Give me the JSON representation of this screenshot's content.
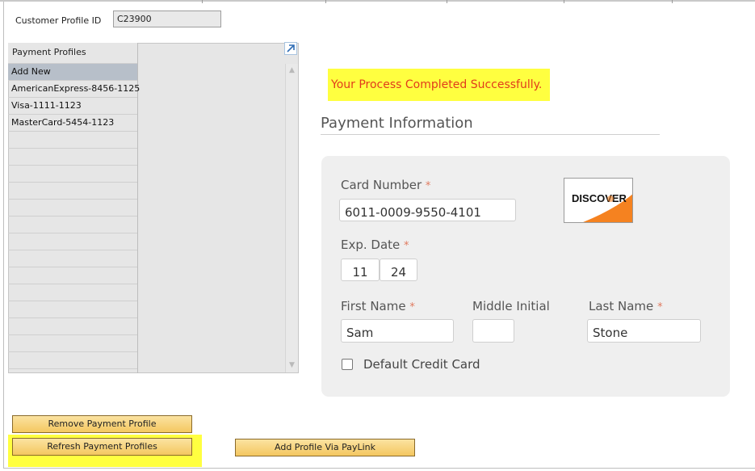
{
  "customer": {
    "label": "Customer Profile ID",
    "value": "C23900"
  },
  "profiles_panel": {
    "header": "Payment Profiles",
    "items": [
      "Add New",
      "AmericanExpress-8456-1125",
      "Visa-1111-1123",
      "MasterCard-5454-1123"
    ],
    "selected_index": 0
  },
  "message": {
    "text": "Your Process Completed Successfully."
  },
  "payment": {
    "title": "Payment Information",
    "card_number_label": "Card Number",
    "card_number_value": "6011-0009-9550-4101",
    "card_brand": "DISCOVER",
    "exp_label": "Exp. Date",
    "exp_month": "11",
    "exp_year": "24",
    "first_name_label": "First Name",
    "first_name_value": "Sam",
    "middle_initial_label": "Middle Initial",
    "middle_initial_value": "",
    "last_name_label": "Last Name",
    "last_name_value": "Stone",
    "required_mark": "*",
    "default_card_label": "Default Credit Card",
    "default_card_checked": false
  },
  "buttons": {
    "remove": "Remove Payment Profile",
    "refresh": "Refresh Payment Profiles",
    "add_paylink": "Add Profile Via PayLink"
  },
  "colors": {
    "highlight": "#ffff40",
    "success_text": "#e23b1b",
    "button_gold": "#f4c760",
    "discover_orange": "#f58220"
  }
}
